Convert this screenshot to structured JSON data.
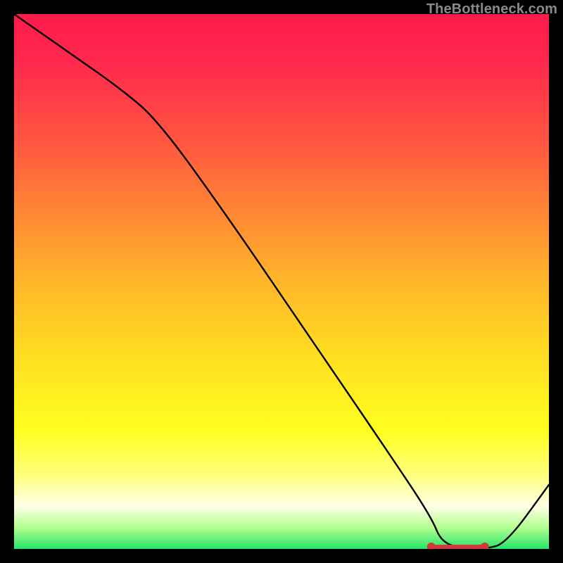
{
  "watermark": "TheBottleneck.com",
  "chart_data": {
    "type": "line",
    "title": "",
    "xlabel": "",
    "ylabel": "",
    "xlim": [
      0,
      100
    ],
    "ylim": [
      0,
      100
    ],
    "x": [
      0,
      10,
      20,
      27,
      40,
      55,
      70,
      78,
      80,
      85,
      88,
      92,
      100
    ],
    "values": [
      100,
      93,
      86,
      80,
      62,
      40,
      18,
      6,
      1,
      0,
      0,
      1,
      12
    ],
    "marker_band": {
      "x_start": 78,
      "x_end": 88,
      "y": 0,
      "end_caps": true
    },
    "grid": false,
    "legend": false
  }
}
